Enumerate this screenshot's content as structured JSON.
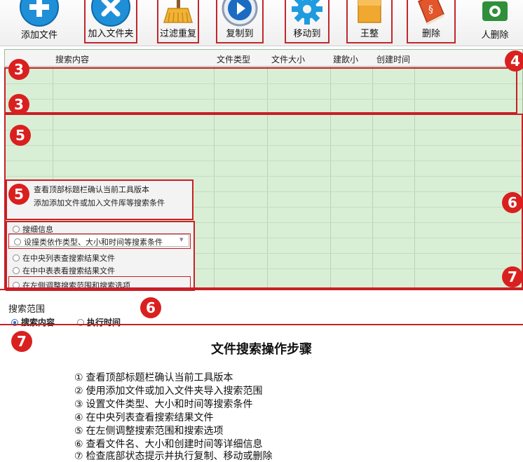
{
  "toolbar": {
    "buttons": [
      {
        "label": "添加文件",
        "icon": "plus-icon"
      },
      {
        "label": "加入文件夹",
        "icon": "close-icon"
      },
      {
        "label": "过滤重复",
        "icon": "broom-icon"
      },
      {
        "label": "复制到",
        "icon": "play-icon"
      },
      {
        "label": "移动到",
        "icon": "gear-icon"
      },
      {
        "label": "王整",
        "icon": "folder-icon"
      },
      {
        "label": "删除",
        "icon": "book-icon"
      },
      {
        "label": "人删除",
        "icon": "camera-icon"
      }
    ]
  },
  "table": {
    "columns": [
      "搜索内容",
      "文件类型",
      "文件大小",
      "建飲小",
      "创建时间"
    ]
  },
  "badges": [
    "3",
    "3",
    "4",
    "5",
    "5",
    "6",
    "6",
    "7",
    "7"
  ],
  "panel": {
    "line1": "查看顶部标题栏确认当前工具版本",
    "line2": "添加添加文件或加入文件厍等搜索条件",
    "search_info_label": "搜细信息",
    "select_value": "设撞类依作类型、大小和时间等搜素条件",
    "option1": "在中央列表查搜索结果文件",
    "option2": "在中中表表看搜索结果文件",
    "option3": "在左侧调整搜索范围和搜索选项"
  },
  "scope": {
    "title": "搜索范围",
    "radio1": "搜索内容",
    "radio2": "执行时间"
  },
  "steps": {
    "title": "文件搜索操作步骤",
    "items": [
      "① 查看顶部标题栏确认当前工具版本",
      "② 使用添加文件或加入文件夹导入搜索范围",
      "③ 设置文件类型、大小和时间等搜索条件",
      "④ 在中央列表查看搜索结果文件",
      "⑤ 在左侧调整搜索范围和搜索选项",
      "⑥ 查看文件名、大小和创建时间等详细信息",
      "⑦ 检查底部状态提示并执行复制、移动或删除"
    ]
  },
  "colors": {
    "accent_red": "#c91f25",
    "table_green": "#d8efd6",
    "icon_blue": "#1f8fd8"
  }
}
